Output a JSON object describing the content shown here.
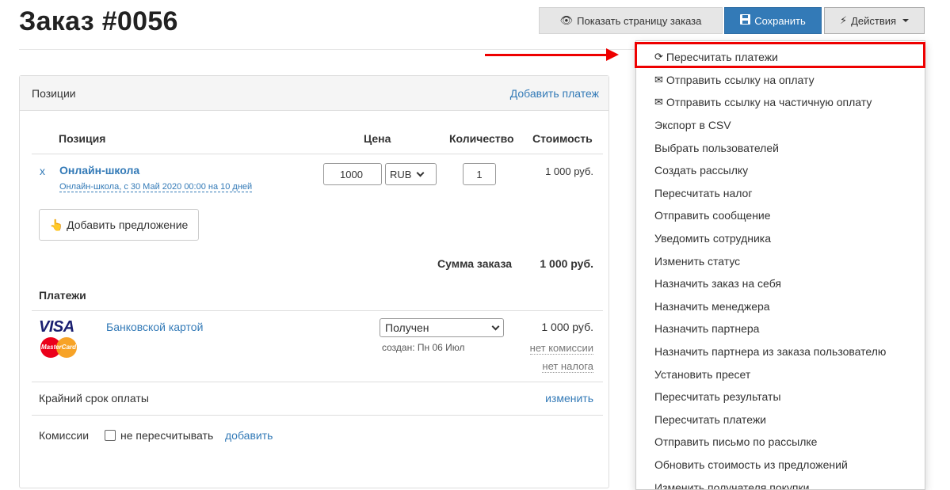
{
  "page": {
    "title": "Заказ #0056"
  },
  "toolbar": {
    "show_order_label": "Показать страницу заказа",
    "save_label": "Сохранить",
    "actions_label": "Действия"
  },
  "panel": {
    "heading": "Позиции",
    "add_payment": "Добавить платеж",
    "columns": [
      "Позиция",
      "Цена",
      "Количество",
      "Стоимость"
    ],
    "item": {
      "remove": "x",
      "name": "Онлайн-школа",
      "subtitle": "Онлайн-школа, с 30 Май 2020 00:00 на 10 дней",
      "price": "1000",
      "currency": "RUB",
      "quantity": "1",
      "cost": "1 000 руб."
    },
    "add_offer_label": "Добавить предложение",
    "sum_label": "Сумма заказа",
    "sum_value": "1 000 руб."
  },
  "payments": {
    "title": "Платежи",
    "visa_label": "VISA",
    "mastercard_label": "MasterCard",
    "method": "Банковской картой",
    "status": "Получен",
    "created": "создан: Пн 06 Июл",
    "amount": "1 000 руб.",
    "no_commission": "нет комиссии",
    "no_tax": "нет налога"
  },
  "deadline": {
    "label": "Крайний срок оплаты",
    "change": "изменить"
  },
  "commissions": {
    "label": "Комиссии",
    "checkbox_label": "не пересчитывать",
    "checked": false,
    "add": "добавить"
  },
  "menu": {
    "items": [
      {
        "label": "Пересчитать платежи",
        "icon": "refresh-icon"
      },
      {
        "label": "Отправить ссылку на оплату",
        "icon": "envelope-icon"
      },
      {
        "label": "Отправить ссылку на частичную оплату",
        "icon": "envelope-icon"
      },
      {
        "label": "Экспорт в CSV"
      },
      {
        "label": "Выбрать пользователей"
      },
      {
        "label": "Создать рассылку"
      },
      {
        "label": "Пересчитать налог"
      },
      {
        "label": "Отправить сообщение"
      },
      {
        "label": "Уведомить сотрудника"
      },
      {
        "label": "Изменить статус"
      },
      {
        "label": "Назначить заказ на себя"
      },
      {
        "label": "Назначить менеджера"
      },
      {
        "label": "Назначить партнера"
      },
      {
        "label": "Назначить партнера из заказа пользователю"
      },
      {
        "label": "Установить пресет"
      },
      {
        "label": "Пересчитать результаты"
      },
      {
        "label": "Пересчитать платежи"
      },
      {
        "label": "Отправить письмо по рассылке"
      },
      {
        "label": "Обновить стоимость из предложений"
      },
      {
        "label": "Изменить получателя покупки"
      }
    ]
  },
  "colors": {
    "primary": "#337ab7",
    "highlight": "#ee0000",
    "button_gray": "#e6e6e6"
  }
}
